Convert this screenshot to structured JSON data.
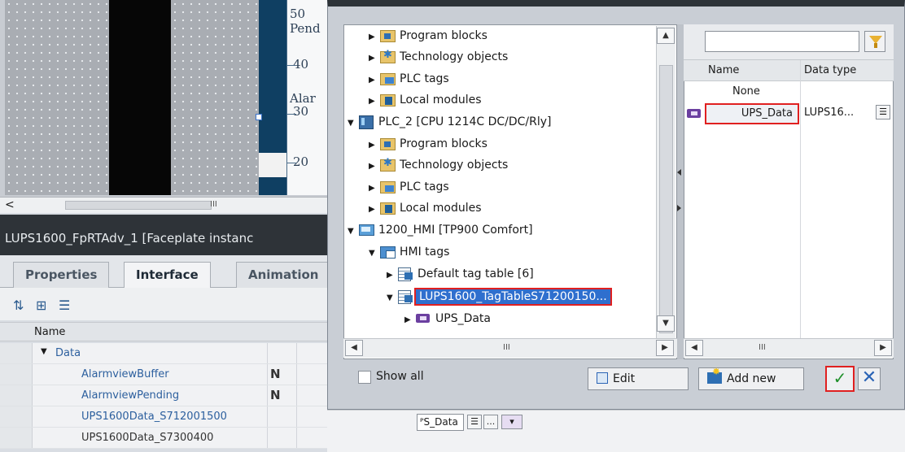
{
  "editor": {
    "scale_top": "50",
    "scale_40": "40",
    "scale_30": "30",
    "scale_20": "20",
    "label_pend": "Pend",
    "label_alar": "Alar",
    "scroll_left": "<",
    "scroll_mid": "III"
  },
  "panel": {
    "title": "LUPS1600_FpRTAdv_1 [Faceplate instanc",
    "tabs": [
      {
        "label": "Properties"
      },
      {
        "label": "Interface"
      },
      {
        "label": "Animation"
      }
    ],
    "table_header": "Name",
    "rows": [
      {
        "label": "Data",
        "expander": "▼"
      },
      {
        "label": "AlarmviewBuffer",
        "flag": "N"
      },
      {
        "label": "AlarmviewPending",
        "flag": "N"
      },
      {
        "label": "UPS1600Data_S712001500"
      },
      {
        "label": "UPS1600Data_S7300400"
      }
    ]
  },
  "inline_control": {
    "value": "ᴾS_Data",
    "more": "..."
  },
  "tree": {
    "nodes": [
      {
        "label": "Program blocks"
      },
      {
        "label": "Technology objects"
      },
      {
        "label": "PLC tags"
      },
      {
        "label": "Local modules"
      },
      {
        "label": "PLC_2 [CPU 1214C DC/DC/Rly]"
      },
      {
        "label": "Program blocks"
      },
      {
        "label": "Technology objects"
      },
      {
        "label": "PLC tags"
      },
      {
        "label": "Local modules"
      },
      {
        "label": "1200_HMI [TP900 Comfort]"
      },
      {
        "label": "HMI tags"
      },
      {
        "label": "Default tag table [6]"
      },
      {
        "label": "LUPS1600_TagTableS71200150..."
      },
      {
        "label": "UPS_Data"
      }
    ],
    "scroll_mid": "III"
  },
  "tag_list": {
    "filter_value": "",
    "headers": {
      "name": "Name",
      "data_type": "Data type"
    },
    "rows": [
      {
        "name": "None",
        "data_type": ""
      },
      {
        "name": "UPS_Data",
        "data_type": "LUPS16..."
      }
    ],
    "scroll_mid": "III"
  },
  "footer": {
    "show_all": "Show all",
    "edit": "Edit",
    "add_new": "Add new",
    "ok": "✓",
    "cancel": "✕"
  },
  "colors": {
    "highlight": "#e02020",
    "selection": "#2f6fce",
    "title_bar": "#2d3338"
  }
}
